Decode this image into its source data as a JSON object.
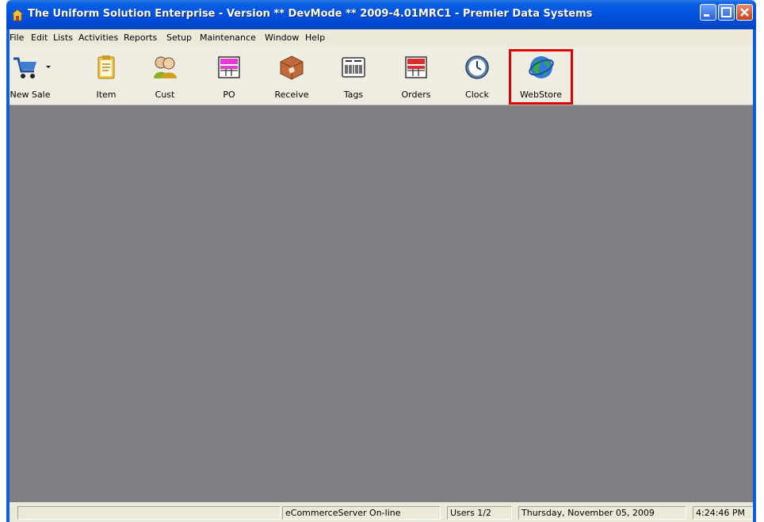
{
  "window": {
    "title": "The Uniform Solution Enterprise - Version ** DevMode ** 2009-4.01MRC1 - Premier Data Systems",
    "controls": {
      "minimize_icon": "minimize-icon",
      "maximize_icon": "maximize-icon",
      "close_icon": "close-icon"
    }
  },
  "menu": [
    "File",
    "Edit",
    "Lists",
    "Activities",
    "Reports",
    "Setup",
    "Maintenance",
    "Window",
    "Help"
  ],
  "toolbar": {
    "items": [
      {
        "label": "New Sale",
        "icon": "shopping-cart-icon"
      },
      {
        "label": "Item",
        "icon": "clipboard-icon"
      },
      {
        "label": "Cust",
        "icon": "customers-icon"
      },
      {
        "label": "PO",
        "icon": "purchase-order-icon"
      },
      {
        "label": "Receive",
        "icon": "package-icon"
      },
      {
        "label": "Tags",
        "icon": "barcode-tag-icon"
      },
      {
        "label": "Orders",
        "icon": "orders-icon"
      },
      {
        "label": "Clock",
        "icon": "clock-icon"
      },
      {
        "label": "WebStore",
        "icon": "globe-icon"
      }
    ]
  },
  "status": {
    "panel1": "",
    "server": "eCommerceServer On-line",
    "users": "Users 1/2",
    "date": "Thursday, November 05, 2009",
    "time": "4:24:46 PM"
  },
  "colors": {
    "title_blue": "#0054E3",
    "client_gray": "#807E82",
    "highlight_red": "#E00000"
  }
}
